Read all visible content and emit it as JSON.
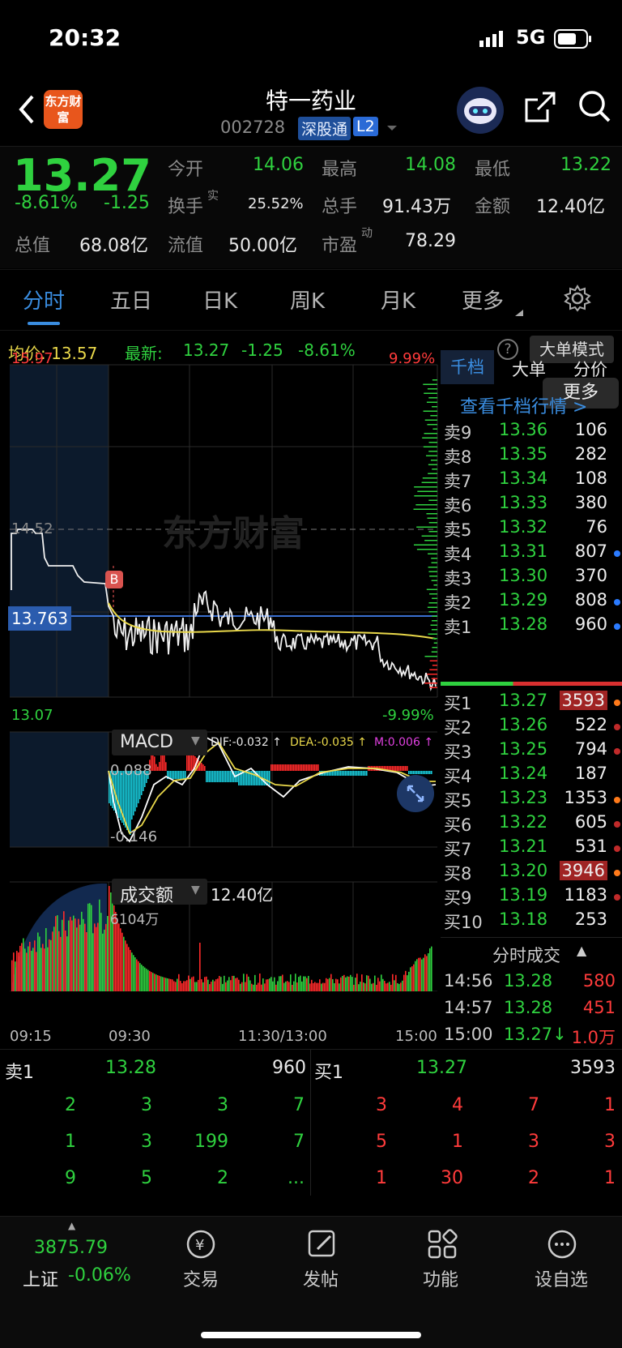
{
  "status_bar": {
    "time": "20:32",
    "network": "5G"
  },
  "header": {
    "title": "特一药业",
    "code": "002728",
    "exchange_badge": "深股通",
    "level_badge": "L2",
    "app_logo_text": "东方财富"
  },
  "quote": {
    "price": "13.27",
    "change_pct": "-8.61%",
    "change_amt": "-1.25",
    "open_label": "今开",
    "open": "14.06",
    "high_label": "最高",
    "high": "14.08",
    "low_label": "最低",
    "low": "13.22",
    "turnover_label": "换手",
    "turnover_sup": "实",
    "turnover": "25.52%",
    "volume_label": "总手",
    "volume": "91.43万",
    "amount_label": "金额",
    "amount": "12.40亿",
    "mktcap_label": "总值",
    "mktcap": "68.08亿",
    "float_label": "流值",
    "float": "50.00亿",
    "pe_label": "市盈",
    "pe_sup": "动",
    "pe": "78.29",
    "more_button": "更多"
  },
  "tabs": [
    "分时",
    "五日",
    "日K",
    "周K",
    "月K",
    "更多"
  ],
  "info_line": {
    "avg_label": "均价:",
    "avg": "13.57",
    "latest_label": "最新:",
    "latest": "13.27",
    "chg": "-1.25",
    "chg_pct": "-8.61%",
    "mode_button": "大单模式"
  },
  "chart_labels": {
    "price_top": "15.97",
    "pct_top": "9.99%",
    "price_mid": "14.52",
    "cursor_price": "13.763",
    "price_bottom": "13.07",
    "pct_bottom": "-9.99%",
    "watermark": "东方财富",
    "marker": "B",
    "macd_label": "MACD",
    "dif": "DIF:-0.032 ↑",
    "dea": "DEA:-0.035 ↑",
    "m": "M:0.006 ↑",
    "macd_top": "0.088",
    "macd_bottom": "-0.146",
    "vol_label": "成交额",
    "vol_total": "12.40亿",
    "vol_max": "6104万",
    "times": [
      "09:15",
      "09:30",
      "11:30/13:00",
      "15:00"
    ]
  },
  "orderbook": {
    "tabs": [
      "千档",
      "大单",
      "分价"
    ],
    "link": "查看千档行情 >",
    "sells": [
      {
        "label": "卖9",
        "price": "13.36",
        "vol": "106"
      },
      {
        "label": "卖8",
        "price": "13.35",
        "vol": "282"
      },
      {
        "label": "卖7",
        "price": "13.34",
        "vol": "108"
      },
      {
        "label": "卖6",
        "price": "13.33",
        "vol": "380"
      },
      {
        "label": "卖5",
        "price": "13.32",
        "vol": "76"
      },
      {
        "label": "卖4",
        "price": "13.31",
        "vol": "807"
      },
      {
        "label": "卖3",
        "price": "13.30",
        "vol": "370"
      },
      {
        "label": "卖2",
        "price": "13.29",
        "vol": "808"
      },
      {
        "label": "卖1",
        "price": "13.28",
        "vol": "960"
      }
    ],
    "buys": [
      {
        "label": "买1",
        "price": "13.27",
        "vol": "3593"
      },
      {
        "label": "买2",
        "price": "13.26",
        "vol": "522"
      },
      {
        "label": "买3",
        "price": "13.25",
        "vol": "794"
      },
      {
        "label": "买4",
        "price": "13.24",
        "vol": "187"
      },
      {
        "label": "买5",
        "price": "13.23",
        "vol": "1353"
      },
      {
        "label": "买6",
        "price": "13.22",
        "vol": "605"
      },
      {
        "label": "买7",
        "price": "13.21",
        "vol": "531"
      },
      {
        "label": "买8",
        "price": "13.20",
        "vol": "3946"
      },
      {
        "label": "买9",
        "price": "13.19",
        "vol": "1183"
      },
      {
        "label": "买10",
        "price": "13.18",
        "vol": "253"
      }
    ],
    "trades_header": "分时成交",
    "trades": [
      {
        "time": "14:56",
        "price": "13.28",
        "vol": "580"
      },
      {
        "time": "14:57",
        "price": "13.28",
        "vol": "451"
      },
      {
        "time": "15:00",
        "price": "13.27↓",
        "vol": "1.0万"
      }
    ]
  },
  "queue": {
    "sell1_label": "卖1",
    "sell1_price": "13.28",
    "sell1_vol": "960",
    "buy1_label": "买1",
    "buy1_price": "13.27",
    "buy1_vol": "3593",
    "sell_rows": [
      [
        "2",
        "3",
        "3",
        "7"
      ],
      [
        "1",
        "3",
        "199",
        "7"
      ],
      [
        "9",
        "5",
        "2",
        "..."
      ]
    ],
    "buy_rows": [
      [
        "3",
        "4",
        "7",
        "1"
      ],
      [
        "5",
        "1",
        "3",
        "3"
      ],
      [
        "1",
        "30",
        "2",
        "1"
      ]
    ]
  },
  "bottom_nav": {
    "index_value": "3875.79",
    "index_name": "上证",
    "index_chg": "-0.06%",
    "items": [
      "交易",
      "发帖",
      "功能",
      "设自选"
    ]
  },
  "colors": {
    "up": "#ff3b3b",
    "down": "#2fd13f",
    "accent": "#3a8de0",
    "avg_line": "#e9d84a"
  }
}
